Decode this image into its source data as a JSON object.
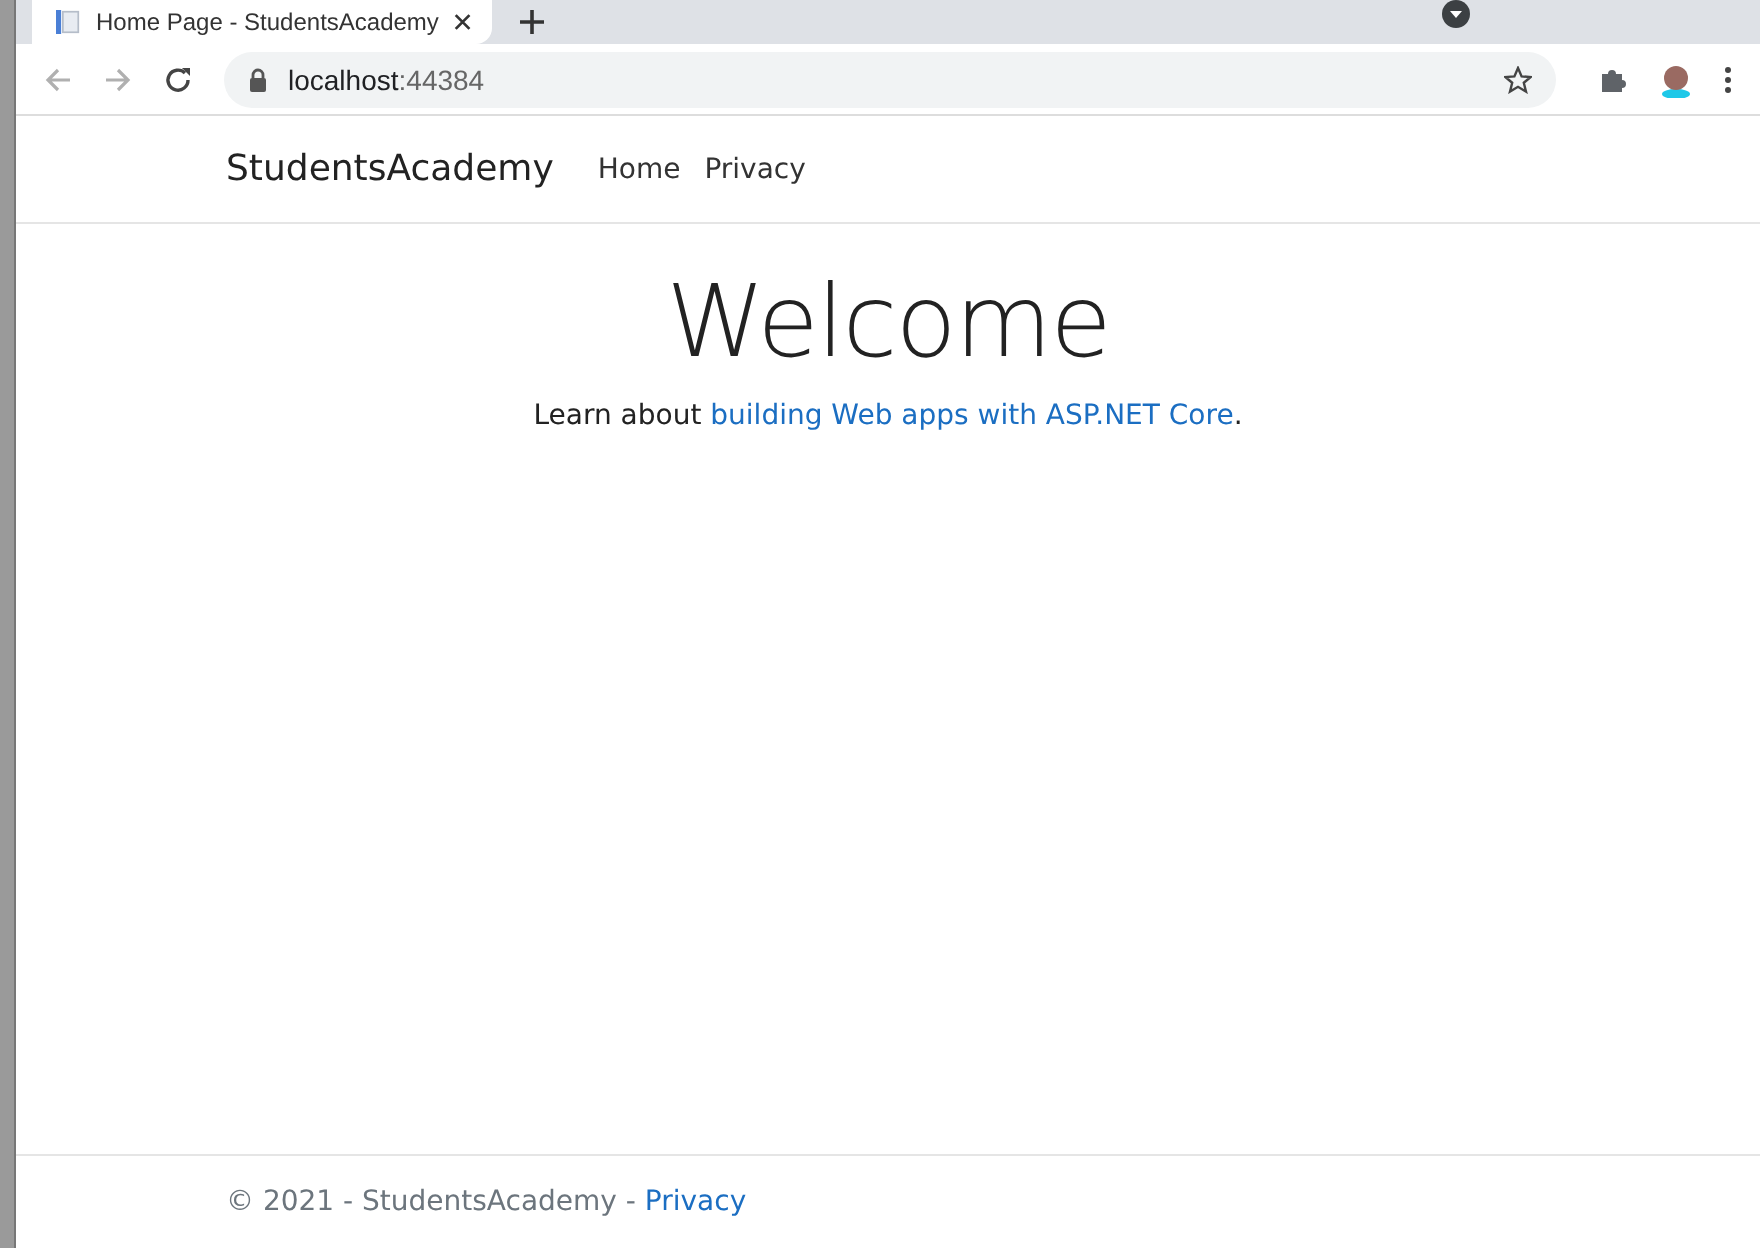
{
  "browser": {
    "tab": {
      "title": "Home Page - StudentsAcademy",
      "selected": true
    },
    "address": {
      "host": "localhost",
      "port": ":44384"
    }
  },
  "navbar": {
    "brand": "StudentsAcademy",
    "links": [
      {
        "label": "Home"
      },
      {
        "label": "Privacy"
      }
    ]
  },
  "main": {
    "heading": "Welcome",
    "text_before": "Learn about ",
    "link": "building Web apps with ASP.NET Core",
    "text_after": "."
  },
  "footer": {
    "text": "© 2021 - StudentsAcademy - ",
    "link": "Privacy"
  }
}
